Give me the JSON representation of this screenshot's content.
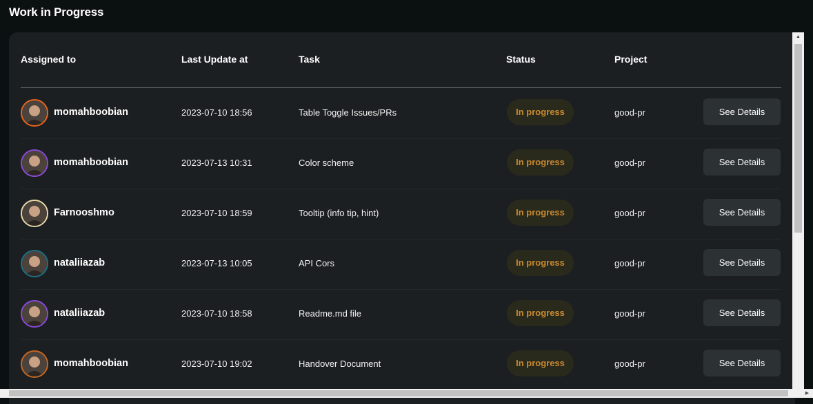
{
  "page": {
    "title": "Work in Progress"
  },
  "table": {
    "headers": {
      "assigned_to": "Assigned to",
      "last_update": "Last Update at",
      "task": "Task",
      "status": "Status",
      "project": "Project"
    },
    "rows": [
      {
        "user": "momahboobian",
        "updated": "2023-07-10 18:56",
        "task": "Table Toggle Issues/PRs",
        "status": "In progress",
        "project": "good-pr",
        "action": "See Details",
        "avatar_ring": "#e8651f"
      },
      {
        "user": "momahboobian",
        "updated": "2023-07-13 10:31",
        "task": "Color scheme",
        "status": "In progress",
        "project": "good-pr",
        "action": "See Details",
        "avatar_ring": "#8b49d9"
      },
      {
        "user": "Farnooshmo",
        "updated": "2023-07-10 18:59",
        "task": "Tooltip (info tip, hint)",
        "status": "In progress",
        "project": "good-pr",
        "action": "See Details",
        "avatar_ring": "#e8d9a8"
      },
      {
        "user": "nataliiazab",
        "updated": "2023-07-13 10:05",
        "task": "API Cors",
        "status": "In progress",
        "project": "good-pr",
        "action": "See Details",
        "avatar_ring": "#1c6f86"
      },
      {
        "user": "nataliiazab",
        "updated": "2023-07-10 18:58",
        "task": "Readme.md file",
        "status": "In progress",
        "project": "good-pr",
        "action": "See Details",
        "avatar_ring": "#8b49d9"
      },
      {
        "user": "momahboobian",
        "updated": "2023-07-10 19:02",
        "task": "Handover Document",
        "status": "In progress",
        "project": "good-pr",
        "action": "See Details",
        "avatar_ring": "#c9681f"
      }
    ]
  },
  "colors": {
    "status_text": "#c8892f",
    "status_bg": "#2a2a1c",
    "card_bg": "#1c1f21",
    "page_bg": "#0b1010"
  }
}
